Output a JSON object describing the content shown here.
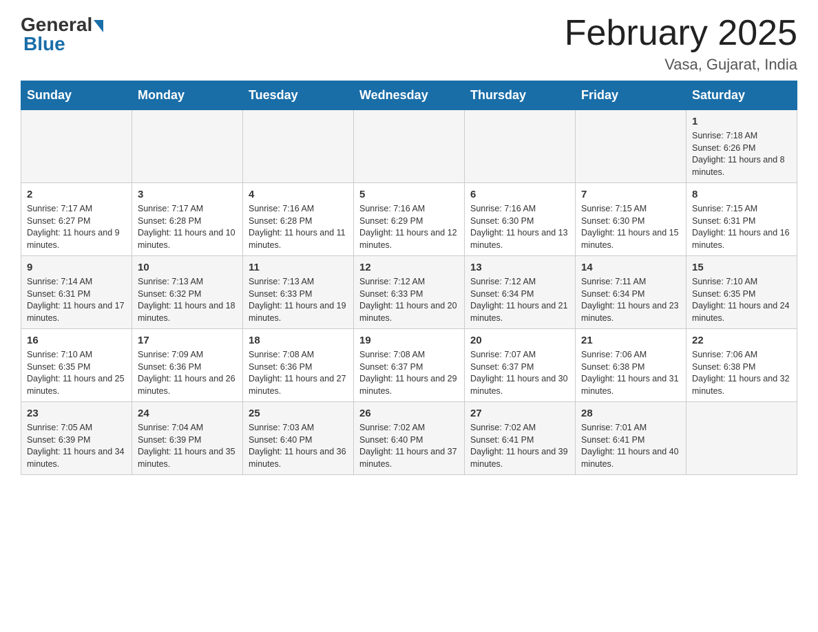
{
  "header": {
    "logo_general": "General",
    "logo_blue": "Blue",
    "month_title": "February 2025",
    "location": "Vasa, Gujarat, India"
  },
  "days_of_week": [
    "Sunday",
    "Monday",
    "Tuesday",
    "Wednesday",
    "Thursday",
    "Friday",
    "Saturday"
  ],
  "weeks": [
    [
      {
        "date": "",
        "info": ""
      },
      {
        "date": "",
        "info": ""
      },
      {
        "date": "",
        "info": ""
      },
      {
        "date": "",
        "info": ""
      },
      {
        "date": "",
        "info": ""
      },
      {
        "date": "",
        "info": ""
      },
      {
        "date": "1",
        "info": "Sunrise: 7:18 AM\nSunset: 6:26 PM\nDaylight: 11 hours and 8 minutes."
      }
    ],
    [
      {
        "date": "2",
        "info": "Sunrise: 7:17 AM\nSunset: 6:27 PM\nDaylight: 11 hours and 9 minutes."
      },
      {
        "date": "3",
        "info": "Sunrise: 7:17 AM\nSunset: 6:28 PM\nDaylight: 11 hours and 10 minutes."
      },
      {
        "date": "4",
        "info": "Sunrise: 7:16 AM\nSunset: 6:28 PM\nDaylight: 11 hours and 11 minutes."
      },
      {
        "date": "5",
        "info": "Sunrise: 7:16 AM\nSunset: 6:29 PM\nDaylight: 11 hours and 12 minutes."
      },
      {
        "date": "6",
        "info": "Sunrise: 7:16 AM\nSunset: 6:30 PM\nDaylight: 11 hours and 13 minutes."
      },
      {
        "date": "7",
        "info": "Sunrise: 7:15 AM\nSunset: 6:30 PM\nDaylight: 11 hours and 15 minutes."
      },
      {
        "date": "8",
        "info": "Sunrise: 7:15 AM\nSunset: 6:31 PM\nDaylight: 11 hours and 16 minutes."
      }
    ],
    [
      {
        "date": "9",
        "info": "Sunrise: 7:14 AM\nSunset: 6:31 PM\nDaylight: 11 hours and 17 minutes."
      },
      {
        "date": "10",
        "info": "Sunrise: 7:13 AM\nSunset: 6:32 PM\nDaylight: 11 hours and 18 minutes."
      },
      {
        "date": "11",
        "info": "Sunrise: 7:13 AM\nSunset: 6:33 PM\nDaylight: 11 hours and 19 minutes."
      },
      {
        "date": "12",
        "info": "Sunrise: 7:12 AM\nSunset: 6:33 PM\nDaylight: 11 hours and 20 minutes."
      },
      {
        "date": "13",
        "info": "Sunrise: 7:12 AM\nSunset: 6:34 PM\nDaylight: 11 hours and 21 minutes."
      },
      {
        "date": "14",
        "info": "Sunrise: 7:11 AM\nSunset: 6:34 PM\nDaylight: 11 hours and 23 minutes."
      },
      {
        "date": "15",
        "info": "Sunrise: 7:10 AM\nSunset: 6:35 PM\nDaylight: 11 hours and 24 minutes."
      }
    ],
    [
      {
        "date": "16",
        "info": "Sunrise: 7:10 AM\nSunset: 6:35 PM\nDaylight: 11 hours and 25 minutes."
      },
      {
        "date": "17",
        "info": "Sunrise: 7:09 AM\nSunset: 6:36 PM\nDaylight: 11 hours and 26 minutes."
      },
      {
        "date": "18",
        "info": "Sunrise: 7:08 AM\nSunset: 6:36 PM\nDaylight: 11 hours and 27 minutes."
      },
      {
        "date": "19",
        "info": "Sunrise: 7:08 AM\nSunset: 6:37 PM\nDaylight: 11 hours and 29 minutes."
      },
      {
        "date": "20",
        "info": "Sunrise: 7:07 AM\nSunset: 6:37 PM\nDaylight: 11 hours and 30 minutes."
      },
      {
        "date": "21",
        "info": "Sunrise: 7:06 AM\nSunset: 6:38 PM\nDaylight: 11 hours and 31 minutes."
      },
      {
        "date": "22",
        "info": "Sunrise: 7:06 AM\nSunset: 6:38 PM\nDaylight: 11 hours and 32 minutes."
      }
    ],
    [
      {
        "date": "23",
        "info": "Sunrise: 7:05 AM\nSunset: 6:39 PM\nDaylight: 11 hours and 34 minutes."
      },
      {
        "date": "24",
        "info": "Sunrise: 7:04 AM\nSunset: 6:39 PM\nDaylight: 11 hours and 35 minutes."
      },
      {
        "date": "25",
        "info": "Sunrise: 7:03 AM\nSunset: 6:40 PM\nDaylight: 11 hours and 36 minutes."
      },
      {
        "date": "26",
        "info": "Sunrise: 7:02 AM\nSunset: 6:40 PM\nDaylight: 11 hours and 37 minutes."
      },
      {
        "date": "27",
        "info": "Sunrise: 7:02 AM\nSunset: 6:41 PM\nDaylight: 11 hours and 39 minutes."
      },
      {
        "date": "28",
        "info": "Sunrise: 7:01 AM\nSunset: 6:41 PM\nDaylight: 11 hours and 40 minutes."
      },
      {
        "date": "",
        "info": ""
      }
    ]
  ]
}
